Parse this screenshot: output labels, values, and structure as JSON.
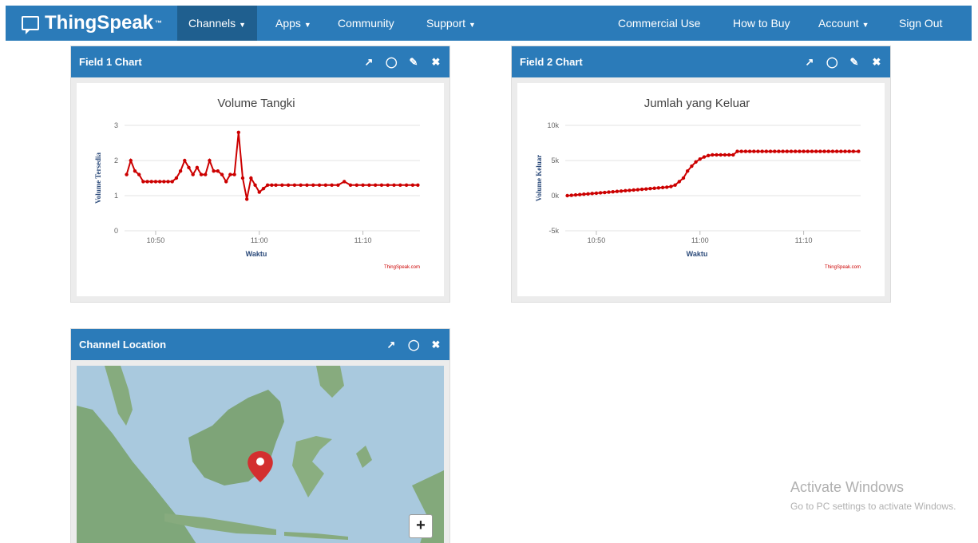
{
  "brand": {
    "name": "ThingSpeak",
    "tm": "™"
  },
  "nav": {
    "left": [
      {
        "label": "Channels",
        "dropdown": true,
        "active": true
      },
      {
        "label": "Apps",
        "dropdown": true
      },
      {
        "label": "Community",
        "dropdown": false
      },
      {
        "label": "Support",
        "dropdown": true
      }
    ],
    "right": [
      {
        "label": "Commercial Use"
      },
      {
        "label": "How to Buy"
      },
      {
        "label": "Account",
        "dropdown": true
      },
      {
        "label": "Sign Out"
      }
    ]
  },
  "panels": {
    "field1": {
      "title": "Field 1 Chart",
      "icons": [
        "external-link-icon",
        "comment-icon",
        "pencil-icon",
        "close-icon"
      ]
    },
    "field2": {
      "title": "Field 2 Chart",
      "icons": [
        "external-link-icon",
        "comment-icon",
        "pencil-icon",
        "close-icon"
      ]
    },
    "location": {
      "title": "Channel Location",
      "icons": [
        "external-link-icon",
        "comment-icon",
        "close-icon"
      ]
    }
  },
  "chart_data": [
    {
      "type": "line",
      "title": "Volume Tangki",
      "xlabel": "Waktu",
      "ylabel": "Volume Tersedia",
      "credit": "ThingSpeak.com",
      "color": "#cc0000",
      "ylim": [
        0,
        3
      ],
      "yticks": [
        "0",
        "1",
        "2",
        "3"
      ],
      "xticks": [
        {
          "label": "10:50",
          "x": 50
        },
        {
          "label": "11:00",
          "x": 60
        },
        {
          "label": "11:10",
          "x": 70
        }
      ],
      "xlim": [
        47,
        75.5
      ],
      "series": [
        {
          "x": [
            47.2,
            47.6,
            48.0,
            48.4,
            48.8,
            49.2,
            49.6,
            50.0,
            50.4,
            50.8,
            51.2,
            51.6,
            52.0,
            52.4,
            52.8,
            53.2,
            53.6,
            54.0,
            54.4,
            54.8,
            55.2,
            55.6,
            56.0,
            56.4,
            56.8,
            57.2,
            57.6,
            58.0,
            58.4,
            58.8,
            59.2,
            59.6,
            60.0,
            60.4,
            60.8,
            61.2,
            61.6,
            62.2,
            62.8,
            63.4,
            64.0,
            64.6,
            65.2,
            65.8,
            66.4,
            67.0,
            67.6,
            68.2,
            68.8,
            69.4,
            70.0,
            70.6,
            71.2,
            71.8,
            72.4,
            73.0,
            73.6,
            74.2,
            74.8,
            75.3
          ],
          "y": [
            1.6,
            2.0,
            1.7,
            1.6,
            1.4,
            1.4,
            1.4,
            1.4,
            1.4,
            1.4,
            1.4,
            1.4,
            1.5,
            1.7,
            2.0,
            1.8,
            1.6,
            1.8,
            1.6,
            1.6,
            2.0,
            1.7,
            1.7,
            1.6,
            1.4,
            1.6,
            1.6,
            2.8,
            1.5,
            0.9,
            1.5,
            1.3,
            1.1,
            1.2,
            1.3,
            1.3,
            1.3,
            1.3,
            1.3,
            1.3,
            1.3,
            1.3,
            1.3,
            1.3,
            1.3,
            1.3,
            1.3,
            1.4,
            1.3,
            1.3,
            1.3,
            1.3,
            1.3,
            1.3,
            1.3,
            1.3,
            1.3,
            1.3,
            1.3,
            1.3
          ]
        }
      ]
    },
    {
      "type": "line",
      "title": "Jumlah yang Keluar",
      "xlabel": "Waktu",
      "ylabel": "Volume Keluar",
      "credit": "ThingSpeak.com",
      "color": "#cc0000",
      "ylim": [
        -5000,
        10000
      ],
      "yticks": [
        "-5k",
        "0k",
        "5k",
        "10k"
      ],
      "xticks": [
        {
          "label": "10:50",
          "x": 50
        },
        {
          "label": "11:00",
          "x": 60
        },
        {
          "label": "11:10",
          "x": 70
        }
      ],
      "xlim": [
        47,
        75.5
      ],
      "series": [
        {
          "x": [
            47.2,
            47.6,
            48.0,
            48.4,
            48.8,
            49.2,
            49.6,
            50.0,
            50.4,
            50.8,
            51.2,
            51.6,
            52.0,
            52.4,
            52.8,
            53.2,
            53.6,
            54.0,
            54.4,
            54.8,
            55.2,
            55.6,
            56.0,
            56.4,
            56.8,
            57.2,
            57.6,
            58.0,
            58.4,
            58.8,
            59.2,
            59.6,
            60.0,
            60.4,
            60.8,
            61.2,
            61.6,
            62.0,
            62.4,
            62.8,
            63.2,
            63.6,
            64.0,
            64.4,
            64.8,
            65.2,
            65.6,
            66.0,
            66.4,
            66.8,
            67.2,
            67.6,
            68.0,
            68.4,
            68.8,
            69.2,
            69.6,
            70.0,
            70.4,
            70.8,
            71.2,
            71.6,
            72.0,
            72.4,
            72.8,
            73.2,
            73.6,
            74.0,
            74.4,
            74.8,
            75.3
          ],
          "y": [
            0,
            50,
            100,
            150,
            200,
            250,
            300,
            350,
            400,
            450,
            500,
            550,
            600,
            650,
            700,
            750,
            800,
            850,
            900,
            950,
            1000,
            1050,
            1100,
            1150,
            1200,
            1300,
            1500,
            2000,
            2500,
            3500,
            4200,
            4800,
            5200,
            5500,
            5700,
            5800,
            5800,
            5800,
            5800,
            5800,
            5800,
            6300,
            6300,
            6300,
            6300,
            6300,
            6300,
            6300,
            6300,
            6300,
            6300,
            6300,
            6300,
            6300,
            6300,
            6300,
            6300,
            6300,
            6300,
            6300,
            6300,
            6300,
            6300,
            6300,
            6300,
            6300,
            6300,
            6300,
            6300,
            6300,
            6300
          ]
        }
      ]
    }
  ],
  "map": {
    "marker_color": "#d32f2f",
    "zoom_in": "+"
  },
  "watermark": {
    "line1": "Activate Windows",
    "line2": "Go to PC settings to activate Windows."
  }
}
